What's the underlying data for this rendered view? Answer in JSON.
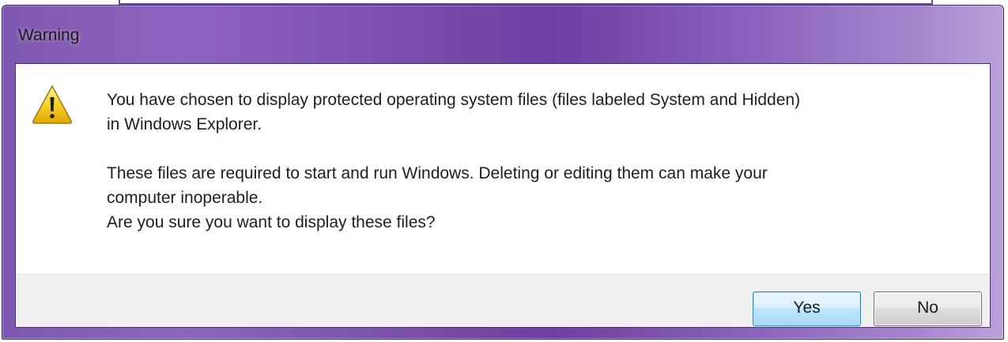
{
  "dialog": {
    "title": "Warning",
    "icon": "warning-icon",
    "message_line1": "You have chosen to display protected operating system files (files labeled System and Hidden)",
    "message_line2": "in Windows Explorer.",
    "message_line3": "These files are required to start and run Windows. Deleting or editing them can make your",
    "message_line4": "computer inoperable.",
    "message_line5": "Are you sure you want to display these files?",
    "buttons": {
      "yes_label": "Yes",
      "no_label": "No"
    }
  },
  "colors": {
    "titlebar_accent": "#7a4fad",
    "default_button": "#bee6fd",
    "warning_icon": "#f5c400"
  }
}
